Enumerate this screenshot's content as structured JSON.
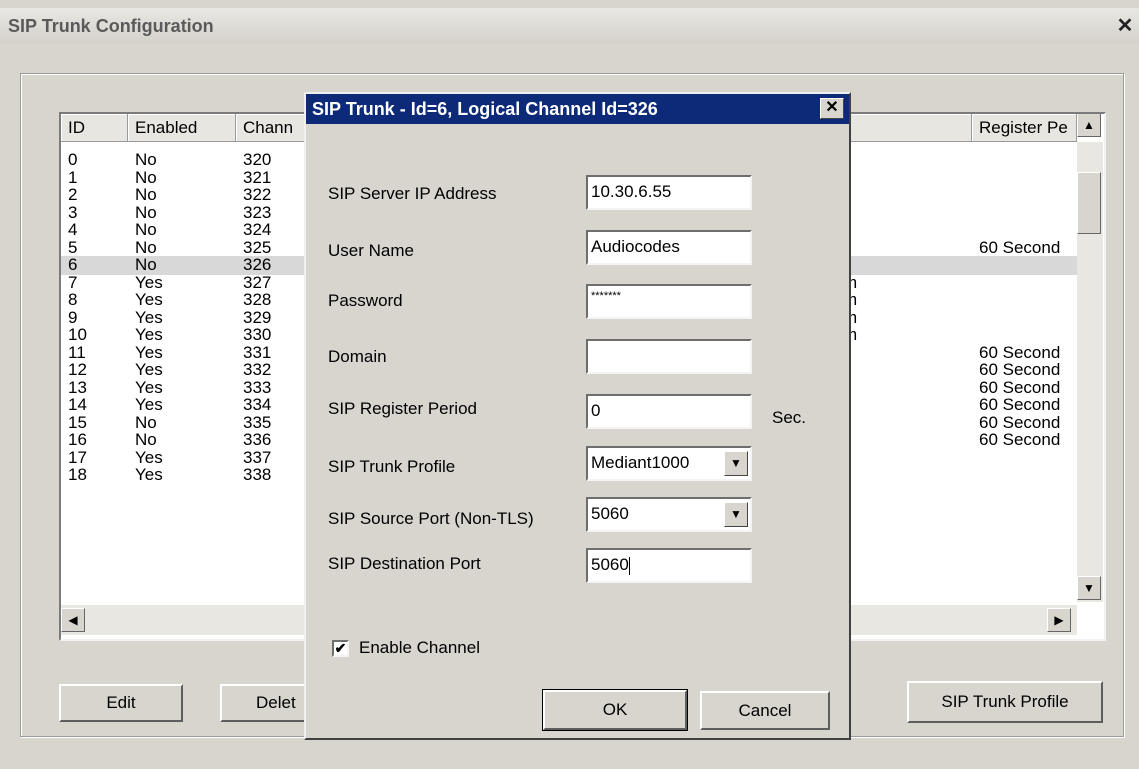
{
  "window": {
    "title": "SIP Trunk Configuration",
    "close_label": "✕"
  },
  "table": {
    "headers": {
      "id": "ID",
      "enabled": "Enabled",
      "channel": "Chann",
      "register_period": "Register Pe"
    },
    "rows": [
      {
        "id": "0",
        "enabled": "No",
        "channel": "320",
        "extra": "",
        "register": ""
      },
      {
        "id": "1",
        "enabled": "No",
        "channel": "321",
        "extra": "",
        "register": ""
      },
      {
        "id": "2",
        "enabled": "No",
        "channel": "322",
        "extra": "",
        "register": ""
      },
      {
        "id": "3",
        "enabled": "No",
        "channel": "323",
        "extra": "",
        "register": ""
      },
      {
        "id": "4",
        "enabled": "No",
        "channel": "324",
        "extra": "",
        "register": ""
      },
      {
        "id": "5",
        "enabled": "No",
        "channel": "325",
        "extra": "",
        "register": "60 Second"
      },
      {
        "id": "6",
        "enabled": "No",
        "channel": "326",
        "extra": "",
        "register": ""
      },
      {
        "id": "7",
        "enabled": "Yes",
        "channel": "327",
        "extra": "m",
        "register": ""
      },
      {
        "id": "8",
        "enabled": "Yes",
        "channel": "328",
        "extra": "m",
        "register": ""
      },
      {
        "id": "9",
        "enabled": "Yes",
        "channel": "329",
        "extra": "m",
        "register": ""
      },
      {
        "id": "10",
        "enabled": "Yes",
        "channel": "330",
        "extra": "m",
        "register": ""
      },
      {
        "id": "11",
        "enabled": "Yes",
        "channel": "331",
        "extra": "",
        "register": "60 Second"
      },
      {
        "id": "12",
        "enabled": "Yes",
        "channel": "332",
        "extra": "",
        "register": "60 Second"
      },
      {
        "id": "13",
        "enabled": "Yes",
        "channel": "333",
        "extra": "",
        "register": "60 Second"
      },
      {
        "id": "14",
        "enabled": "Yes",
        "channel": "334",
        "extra": "",
        "register": "60 Second"
      },
      {
        "id": "15",
        "enabled": "No",
        "channel": "335",
        "extra": "",
        "register": "60 Second"
      },
      {
        "id": "16",
        "enabled": "No",
        "channel": "336",
        "extra": "",
        "register": "60 Second"
      },
      {
        "id": "17",
        "enabled": "Yes",
        "channel": "337",
        "extra": "",
        "register": ""
      },
      {
        "id": "18",
        "enabled": "Yes",
        "channel": "338",
        "extra": "",
        "register": ""
      }
    ],
    "selected_row_id": "6"
  },
  "buttons": {
    "edit": "Edit",
    "delete": "Delet",
    "sip_trunk_profile": "SIP Trunk Profile"
  },
  "dialog": {
    "title": "SIP Trunk - Id=6, Logical Channel Id=326",
    "close_label": "✕",
    "server_ip": {
      "label": "SIP Server IP Address",
      "value": "10.30.6.55"
    },
    "user_name": {
      "label": "User Name",
      "value": "Audiocodes"
    },
    "password": {
      "label": "Password",
      "value": "*******"
    },
    "domain": {
      "label": "Domain",
      "value": ""
    },
    "register_period": {
      "label": "SIP Register Period",
      "value": "0",
      "unit": "Sec."
    },
    "trunk_profile": {
      "label": "SIP Trunk Profile",
      "value": "Mediant1000"
    },
    "source_port": {
      "label": "SIP Source Port (Non-TLS)",
      "value": "5060"
    },
    "destination_port": {
      "label": "SIP Destination Port",
      "value": "5060"
    },
    "enable_channel": {
      "label": "Enable Channel",
      "checked": true,
      "check_glyph": "✔"
    },
    "ok_label": "OK",
    "cancel_label": "Cancel"
  },
  "icons": {
    "up": "up-arrow-icon",
    "down": "down-arrow-icon",
    "left": "left-arrow-icon",
    "right": "right-arrow-icon"
  }
}
